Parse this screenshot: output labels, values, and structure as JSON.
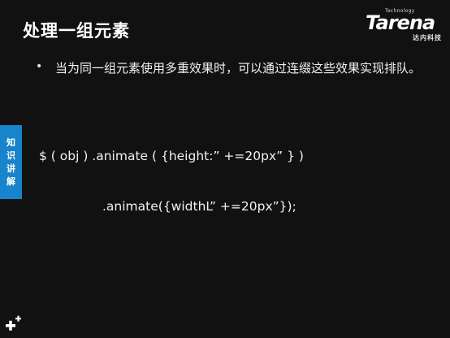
{
  "slide": {
    "title": "处理一组元素",
    "bullet": "当为同一组元素使用多重效果时，可以通过连缀这些效果实现排队。",
    "code_line_1": "$ ( obj ) .animate ( {height:” +=20px” } )",
    "code_line_2": ".animate({widthL” +=20px”});"
  },
  "logo": {
    "small_text": "Technology",
    "main_text": "Tarena",
    "sub_text": "达内科技"
  },
  "side_tab": {
    "chars": [
      "知",
      "识",
      "讲",
      "解"
    ]
  },
  "colors": {
    "background": "#111111",
    "side_tab": "#1784cc",
    "text": "#f2f2f2"
  },
  "icons": {
    "bottom_left": "plus-sparkle-icon"
  }
}
